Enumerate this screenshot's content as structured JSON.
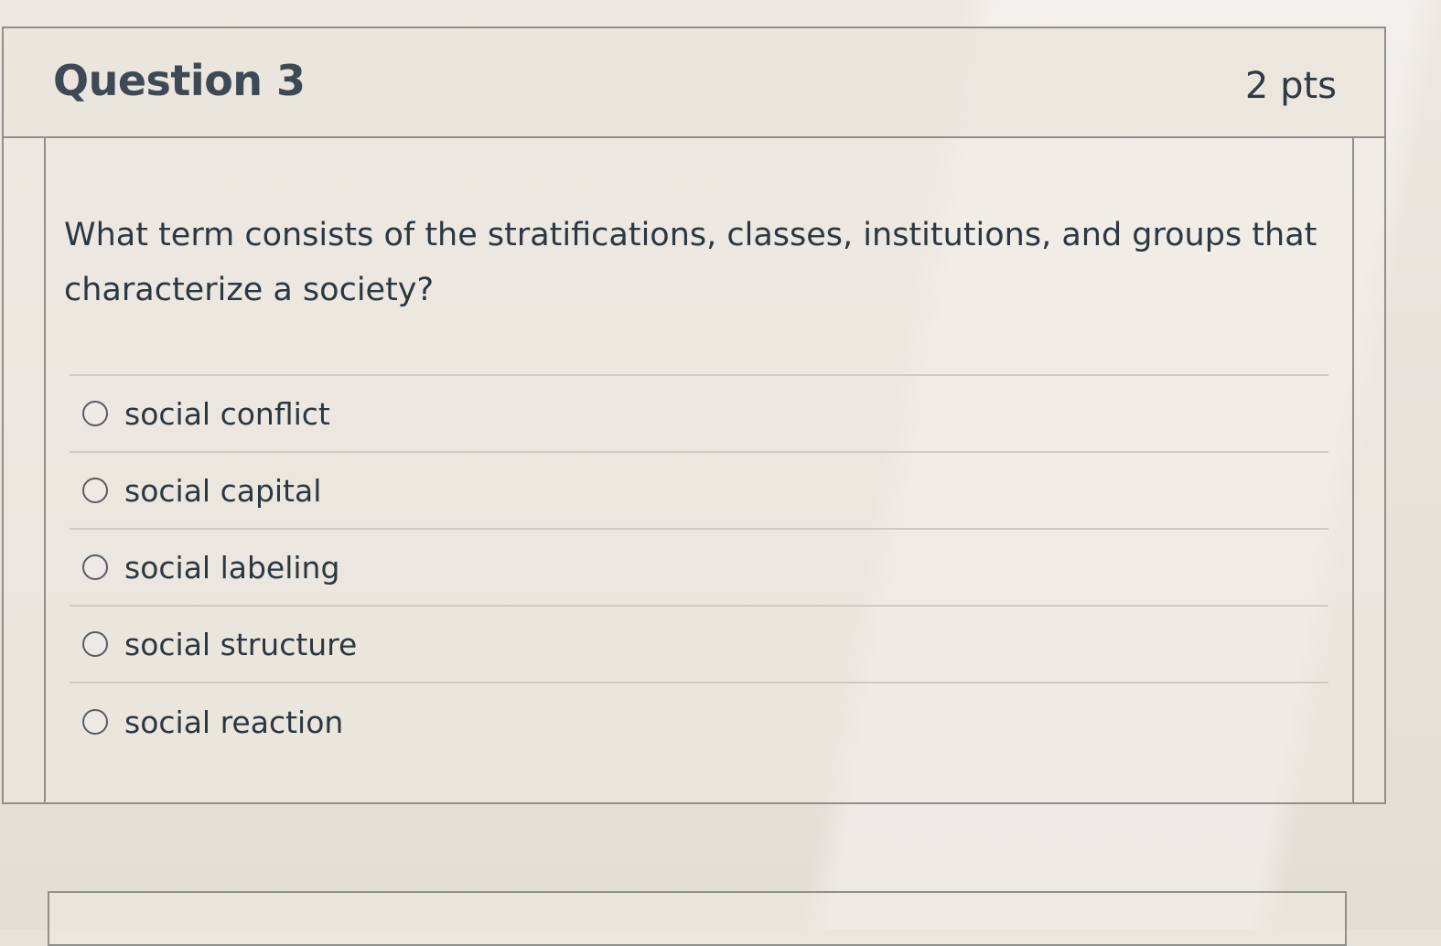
{
  "question": {
    "title": "Question 3",
    "points": "2 pts",
    "text": "What term consists of the stratifications, classes, institutions, and groups that characterize a society?"
  },
  "answers": [
    {
      "label": "social conflict",
      "selected": false
    },
    {
      "label": "social capital",
      "selected": false
    },
    {
      "label": "social labeling",
      "selected": false
    },
    {
      "label": "social structure",
      "selected": false
    },
    {
      "label": "social reaction",
      "selected": false
    }
  ]
}
